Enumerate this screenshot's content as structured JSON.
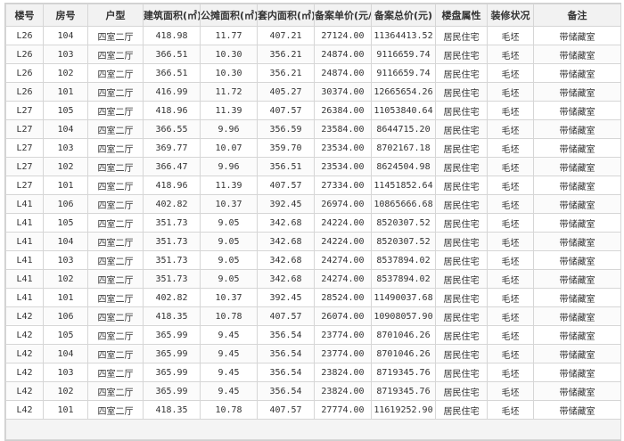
{
  "columns": [
    "楼号",
    "房号",
    "户型",
    "建筑面积(㎡)",
    "公摊面积(㎡)",
    "套内面积(㎡)",
    "备案单价(元/㎡)",
    "备案总价(元)",
    "楼盘属性",
    "装修状况",
    "备注"
  ],
  "rows": [
    [
      "L26",
      "104",
      "四室二厅",
      "418.98",
      "11.77",
      "407.21",
      "27124.00",
      "11364413.52",
      "居民住宅",
      "毛坯",
      "带储藏室"
    ],
    [
      "L26",
      "103",
      "四室二厅",
      "366.51",
      "10.30",
      "356.21",
      "24874.00",
      "9116659.74",
      "居民住宅",
      "毛坯",
      "带储藏室"
    ],
    [
      "L26",
      "102",
      "四室二厅",
      "366.51",
      "10.30",
      "356.21",
      "24874.00",
      "9116659.74",
      "居民住宅",
      "毛坯",
      "带储藏室"
    ],
    [
      "L26",
      "101",
      "四室二厅",
      "416.99",
      "11.72",
      "405.27",
      "30374.00",
      "12665654.26",
      "居民住宅",
      "毛坯",
      "带储藏室"
    ],
    [
      "L27",
      "105",
      "四室二厅",
      "418.96",
      "11.39",
      "407.57",
      "26384.00",
      "11053840.64",
      "居民住宅",
      "毛坯",
      "带储藏室"
    ],
    [
      "L27",
      "104",
      "四室二厅",
      "366.55",
      "9.96",
      "356.59",
      "23584.00",
      "8644715.20",
      "居民住宅",
      "毛坯",
      "带储藏室"
    ],
    [
      "L27",
      "103",
      "四室二厅",
      "369.77",
      "10.07",
      "359.70",
      "23534.00",
      "8702167.18",
      "居民住宅",
      "毛坯",
      "带储藏室"
    ],
    [
      "L27",
      "102",
      "四室二厅",
      "366.47",
      "9.96",
      "356.51",
      "23534.00",
      "8624504.98",
      "居民住宅",
      "毛坯",
      "带储藏室"
    ],
    [
      "L27",
      "101",
      "四室二厅",
      "418.96",
      "11.39",
      "407.57",
      "27334.00",
      "11451852.64",
      "居民住宅",
      "毛坯",
      "带储藏室"
    ],
    [
      "L41",
      "106",
      "四室二厅",
      "402.82",
      "10.37",
      "392.45",
      "26974.00",
      "10865666.68",
      "居民住宅",
      "毛坯",
      "带储藏室"
    ],
    [
      "L41",
      "105",
      "四室二厅",
      "351.73",
      "9.05",
      "342.68",
      "24224.00",
      "8520307.52",
      "居民住宅",
      "毛坯",
      "带储藏室"
    ],
    [
      "L41",
      "104",
      "四室二厅",
      "351.73",
      "9.05",
      "342.68",
      "24224.00",
      "8520307.52",
      "居民住宅",
      "毛坯",
      "带储藏室"
    ],
    [
      "L41",
      "103",
      "四室二厅",
      "351.73",
      "9.05",
      "342.68",
      "24274.00",
      "8537894.02",
      "居民住宅",
      "毛坯",
      "带储藏室"
    ],
    [
      "L41",
      "102",
      "四室二厅",
      "351.73",
      "9.05",
      "342.68",
      "24274.00",
      "8537894.02",
      "居民住宅",
      "毛坯",
      "带储藏室"
    ],
    [
      "L41",
      "101",
      "四室二厅",
      "402.82",
      "10.37",
      "392.45",
      "28524.00",
      "11490037.68",
      "居民住宅",
      "毛坯",
      "带储藏室"
    ],
    [
      "L42",
      "106",
      "四室二厅",
      "418.35",
      "10.78",
      "407.57",
      "26074.00",
      "10908057.90",
      "居民住宅",
      "毛坯",
      "带储藏室"
    ],
    [
      "L42",
      "105",
      "四室二厅",
      "365.99",
      "9.45",
      "356.54",
      "23774.00",
      "8701046.26",
      "居民住宅",
      "毛坯",
      "带储藏室"
    ],
    [
      "L42",
      "104",
      "四室二厅",
      "365.99",
      "9.45",
      "356.54",
      "23774.00",
      "8701046.26",
      "居民住宅",
      "毛坯",
      "带储藏室"
    ],
    [
      "L42",
      "103",
      "四室二厅",
      "365.99",
      "9.45",
      "356.54",
      "23824.00",
      "8719345.76",
      "居民住宅",
      "毛坯",
      "带储藏室"
    ],
    [
      "L42",
      "102",
      "四室二厅",
      "365.99",
      "9.45",
      "356.54",
      "23824.00",
      "8719345.76",
      "居民住宅",
      "毛坯",
      "带储藏室"
    ],
    [
      "L42",
      "101",
      "四室二厅",
      "418.35",
      "10.78",
      "407.57",
      "27774.00",
      "11619252.90",
      "居民住宅",
      "毛坯",
      "带储藏室"
    ]
  ]
}
